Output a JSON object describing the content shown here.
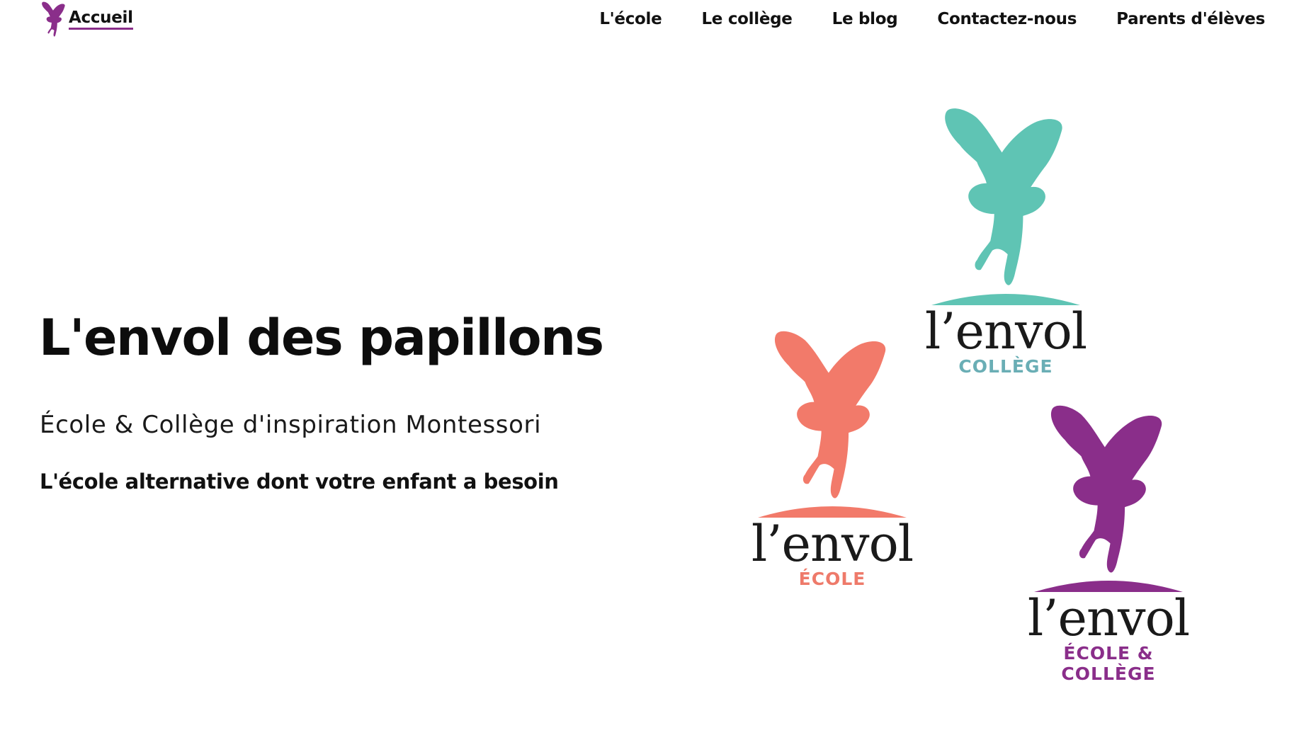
{
  "header": {
    "home_label": "Accueil",
    "nav": [
      {
        "label": "L'école"
      },
      {
        "label": "Le collège"
      },
      {
        "label": "Le blog"
      },
      {
        "label": "Contactez-nous"
      },
      {
        "label": "Parents d'élèves"
      }
    ]
  },
  "hero": {
    "title": "L'envol des papillons",
    "subtitle": "École & Collège d'inspiration Montessori",
    "tagline": "L'école alternative dont votre enfant a besoin"
  },
  "logos": [
    {
      "word": "l’envol",
      "caption": "COLLÈGE",
      "color": "#5fc4b4",
      "caption_color": "#6aaeb5"
    },
    {
      "word": "l’envol",
      "caption": "ÉCOLE",
      "color": "#f27a6a",
      "caption_color": "#ee7a6a"
    },
    {
      "word": "l’envol",
      "caption_line1": "ÉCOLE &",
      "caption_line2": "COLLÈGE",
      "color": "#8a2e8a",
      "caption_color": "#8a2e8a"
    }
  ],
  "colors": {
    "accent": "#8a2e8a",
    "teal": "#5fc4b4",
    "coral": "#f27a6a",
    "purple": "#8a2e8a"
  },
  "icons": {
    "home_logo": "butterfly-fairy-icon"
  }
}
